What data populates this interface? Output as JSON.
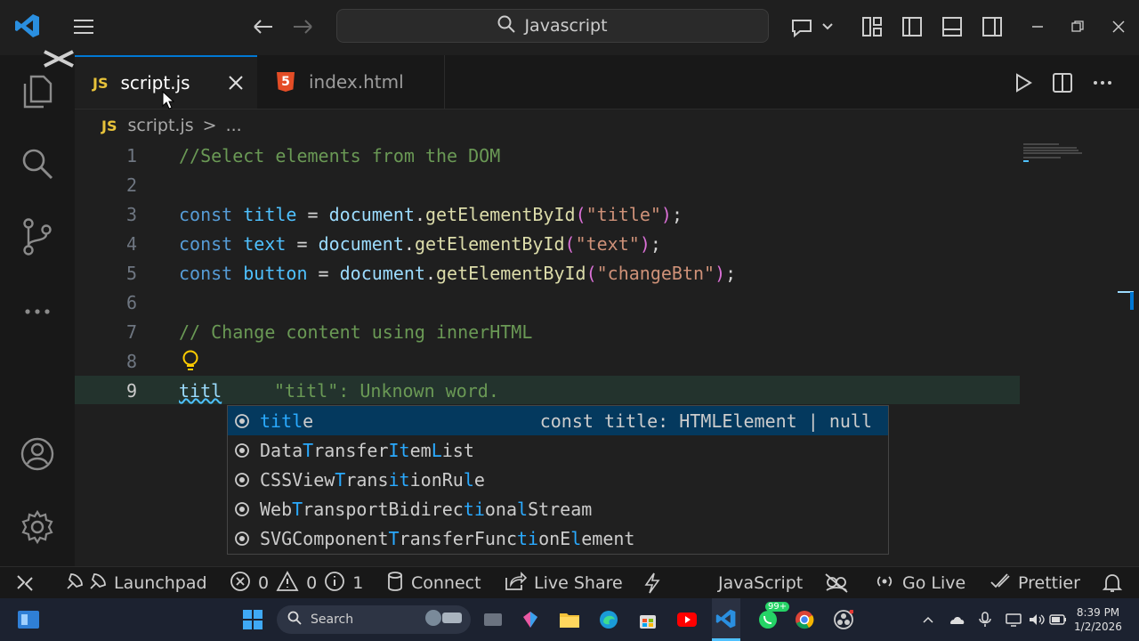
{
  "titlebar": {
    "search_text": "Javascript"
  },
  "tabs": [
    {
      "label": "script.js",
      "badge": "JS"
    },
    {
      "label": "index.html",
      "badge": "5"
    }
  ],
  "breadcrumb": {
    "badge": "JS",
    "file": "script.js",
    "sep": ">",
    "more": "..."
  },
  "editor": {
    "line_numbers": [
      "1",
      "2",
      "3",
      "4",
      "5",
      "6",
      "7",
      "8",
      "9"
    ],
    "lines": {
      "l1": "//Select elements from the DOM",
      "l7": "// Change content using innerHTML",
      "l9_typed": "titl",
      "l9_diagnostic": "\"titl\": Unknown word."
    },
    "l3": {
      "kw": "const",
      "name": "title",
      "eq": " = ",
      "obj": "document",
      "dot": ".",
      "fn": "getElementById",
      "open": "(",
      "arg": "\"title\"",
      "close": ")",
      "semi": ";"
    },
    "l4": {
      "kw": "const",
      "name": "text",
      "eq": " = ",
      "obj": "document",
      "dot": ".",
      "fn": "getElementById",
      "open": "(",
      "arg": "\"text\"",
      "close": ")",
      "semi": ";"
    },
    "l5": {
      "kw": "const",
      "name": "button",
      "eq": " = ",
      "obj": "document",
      "dot": ".",
      "fn": "getElementById",
      "open": "(",
      "arg": "\"changeBtn\"",
      "close": ")",
      "semi": ";"
    }
  },
  "suggestions": {
    "detail": "const title: HTMLElement | null",
    "items": [
      [
        {
          "t": "titl",
          "h": true
        },
        {
          "t": "e",
          "h": false
        }
      ],
      [
        {
          "t": "Data",
          "h": false
        },
        {
          "t": "T",
          "h": true
        },
        {
          "t": "ransfer",
          "h": false
        },
        {
          "t": "It",
          "h": true
        },
        {
          "t": "em",
          "h": false
        },
        {
          "t": "L",
          "h": true
        },
        {
          "t": "ist",
          "h": false
        }
      ],
      [
        {
          "t": "CSSView",
          "h": false
        },
        {
          "t": "T",
          "h": true
        },
        {
          "t": "rans",
          "h": false
        },
        {
          "t": "it",
          "h": true
        },
        {
          "t": "ionRu",
          "h": false
        },
        {
          "t": "l",
          "h": true
        },
        {
          "t": "e",
          "h": false
        }
      ],
      [
        {
          "t": "Web",
          "h": false
        },
        {
          "t": "T",
          "h": true
        },
        {
          "t": "ransportBidirec",
          "h": false
        },
        {
          "t": "ti",
          "h": true
        },
        {
          "t": "ona",
          "h": false
        },
        {
          "t": "l",
          "h": true
        },
        {
          "t": "Stream",
          "h": false
        }
      ],
      [
        {
          "t": "SVGComponent",
          "h": false
        },
        {
          "t": "T",
          "h": true
        },
        {
          "t": "ransferFunc",
          "h": false
        },
        {
          "t": "ti",
          "h": true
        },
        {
          "t": "onE",
          "h": false
        },
        {
          "t": "l",
          "h": true
        },
        {
          "t": "ement",
          "h": false
        }
      ]
    ]
  },
  "statusbar": {
    "launchpad": "Launchpad",
    "errors": "0",
    "warnings": "0",
    "infos": "1",
    "connect": "Connect",
    "liveshare": "Live Share",
    "language": "JavaScript",
    "golive": "Go Live",
    "prettier": "Prettier"
  },
  "taskbar": {
    "search": "Search",
    "whatsapp_badge": "99+",
    "time": "8:39 PM",
    "date": "1/2/2026"
  },
  "colors": {
    "accent": "#0078d4",
    "js_badge": "#e8c33a",
    "html_badge": "#e44d26",
    "match": "#2aaaff",
    "selected": "#04395e"
  }
}
